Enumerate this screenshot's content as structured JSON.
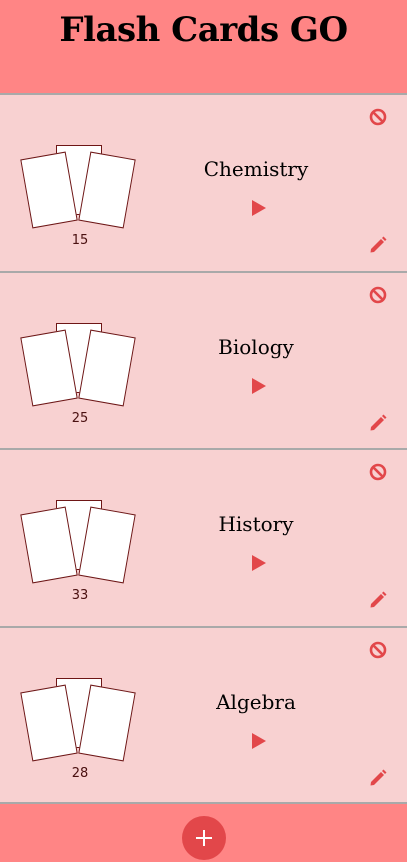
{
  "app": {
    "title": "Flash Cards GO"
  },
  "decks": [
    {
      "name": "Chemistry",
      "count": "15"
    },
    {
      "name": "Biology",
      "count": "25"
    },
    {
      "name": "History",
      "count": "33"
    },
    {
      "name": "Algebra",
      "count": "28"
    }
  ],
  "icons": {
    "delete": "no-entry-icon",
    "play": "play-icon",
    "edit": "pencil-icon",
    "add": "plus-icon"
  },
  "colors": {
    "header": "#ff8585",
    "background": "#f8d1d1",
    "accent": "#e2474a"
  }
}
